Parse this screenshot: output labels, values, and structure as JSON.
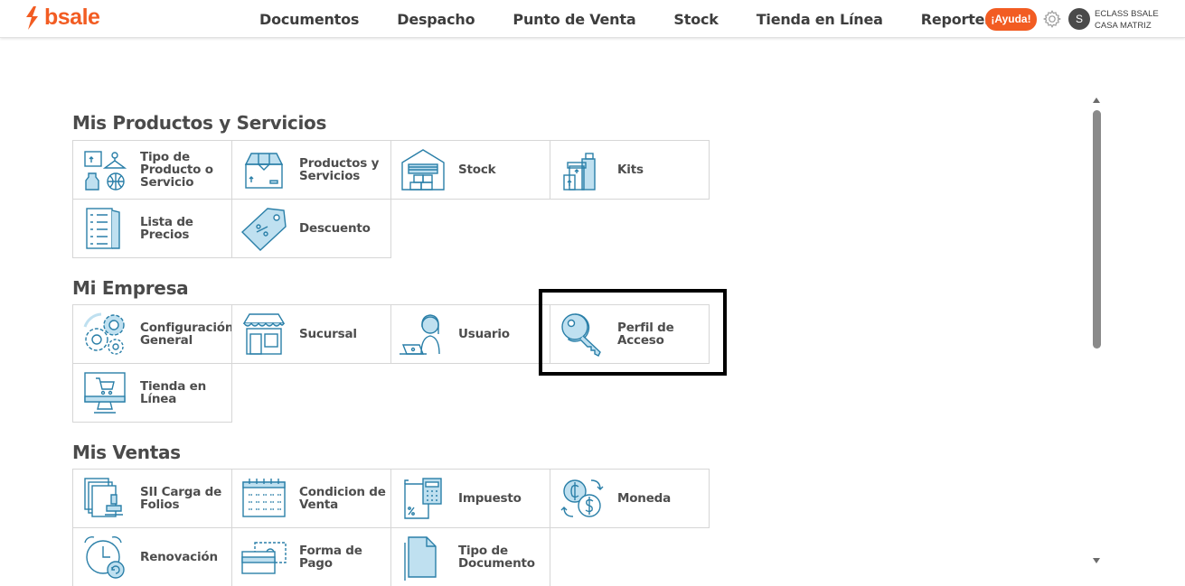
{
  "brand": {
    "name": "bsale",
    "color": "#f25c22"
  },
  "nav": [
    "Documentos",
    "Despacho",
    "Punto de Venta",
    "Stock",
    "Tienda en Línea",
    "Reportes"
  ],
  "header": {
    "help_label": "¡Ayuda!",
    "avatar_initial": "S",
    "account_line1": "ECLASS BSALE",
    "account_line2": "CASA MATRIZ"
  },
  "sections": [
    {
      "title": "Mis Productos y Servicios",
      "tiles": [
        {
          "label": "Tipo de Producto o Servicio",
          "icon": "product-type-icon"
        },
        {
          "label": "Productos y Servicios",
          "icon": "box-icon"
        },
        {
          "label": "Stock",
          "icon": "warehouse-icon"
        },
        {
          "label": "Kits",
          "icon": "kits-icon"
        },
        {
          "label": "Lista de Precios",
          "icon": "price-list-icon"
        },
        {
          "label": "Descuento",
          "icon": "discount-tag-icon"
        }
      ]
    },
    {
      "title": "Mi Empresa",
      "tiles": [
        {
          "label": "Configuración General",
          "icon": "gears-icon"
        },
        {
          "label": "Sucursal",
          "icon": "store-icon"
        },
        {
          "label": "Usuario",
          "icon": "user-laptop-icon"
        },
        {
          "label": "Perfil de Acceso",
          "icon": "key-icon"
        },
        {
          "label": "Tienda en Línea",
          "icon": "monitor-cart-icon"
        }
      ]
    },
    {
      "title": "Mis Ventas",
      "tiles": [
        {
          "label": "SII Carga de Folios",
          "icon": "stamp-icon"
        },
        {
          "label": "Condicion de Venta",
          "icon": "calendar-icon"
        },
        {
          "label": "Impuesto",
          "icon": "tax-calculator-icon"
        },
        {
          "label": "Moneda",
          "icon": "currency-exchange-icon"
        },
        {
          "label": "Renovación",
          "icon": "alarm-clock-icon"
        },
        {
          "label": "Forma de Pago",
          "icon": "payment-cards-icon"
        },
        {
          "label": "Tipo de Documento",
          "icon": "document-type-icon"
        }
      ]
    }
  ],
  "colors": {
    "icon_stroke": "#2a7fa8",
    "icon_fill": "#bfe0f0",
    "accent": "#f25c22"
  }
}
